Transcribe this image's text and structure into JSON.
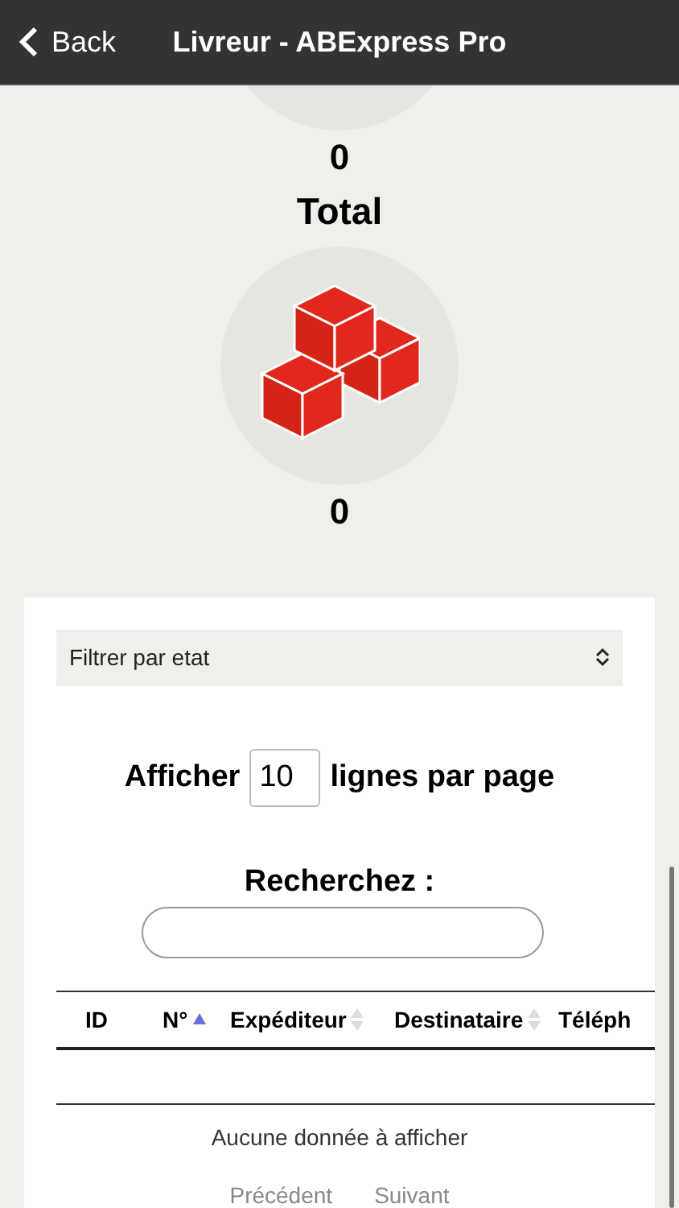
{
  "nav_bar": {
    "back_label": "Back",
    "title": "Livreur - ABExpress Pro"
  },
  "stats": [
    {
      "kind": "cropped",
      "value": "0"
    },
    {
      "kind": "full",
      "label": "Total",
      "value": "0"
    }
  ],
  "panel": {
    "filter": {
      "placeholder": "Filtrer par etat"
    },
    "page_size": {
      "prefix": "Afficher",
      "value": "10",
      "suffix": "lignes par page"
    },
    "search": {
      "label": "Recherchez :"
    },
    "table": {
      "columns": [
        {
          "label": "ID"
        },
        {
          "label": "N°",
          "sorted": true
        },
        {
          "label": "Expéditeur",
          "sorted": false
        },
        {
          "label": "Destinataire",
          "sorted": false
        },
        {
          "label": "Téléph"
        }
      ],
      "empty_message": "Aucune donnée à afficher"
    },
    "pager": [
      "Précédent",
      "Suivant"
    ]
  }
}
